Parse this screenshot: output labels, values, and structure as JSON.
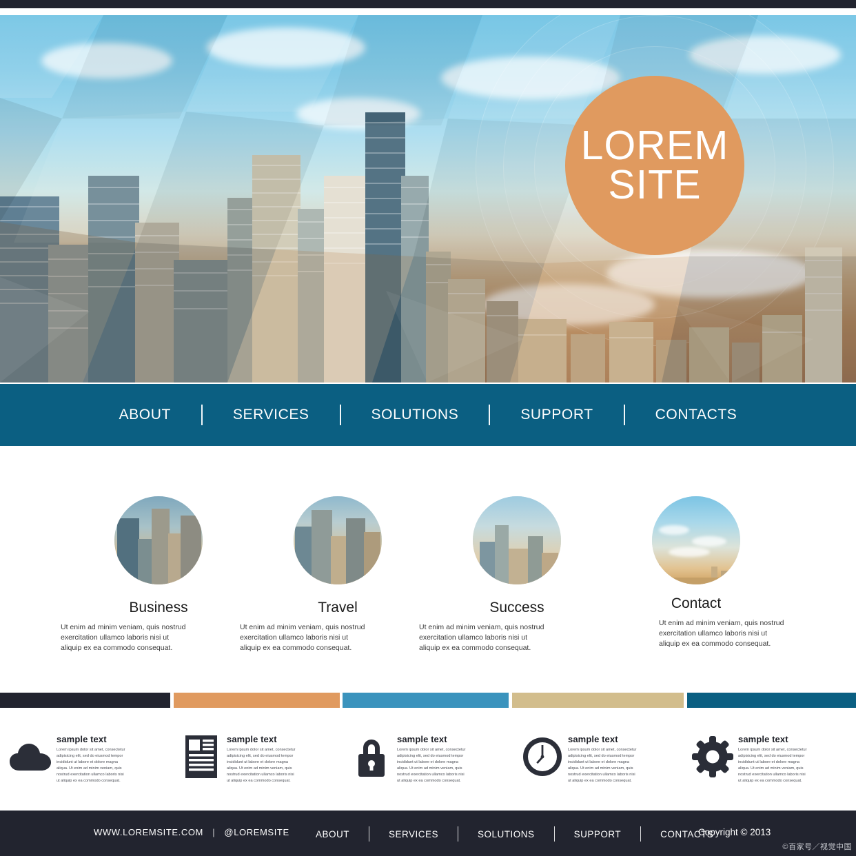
{
  "meta": {
    "colors": {
      "dark": "#22242f",
      "orange": "#e09a5f",
      "light_blue": "#3a93bd",
      "khaki": "#d2bd8c",
      "teal": "#0b5f82"
    }
  },
  "hero": {
    "logo_line1": "LOREM",
    "logo_line2": "SITE"
  },
  "nav": {
    "items": [
      {
        "label": "ABOUT"
      },
      {
        "label": "SERVICES"
      },
      {
        "label": "SOLUTIONS"
      },
      {
        "label": "SUPPORT"
      },
      {
        "label": "CONTACTS"
      }
    ]
  },
  "features": [
    {
      "title": "Business",
      "body": "Ut enim ad minim veniam, quis nostrud exercitation ullamco laboris nisi ut aliquip ex ea commodo consequat.",
      "image": "city-skyline-photo"
    },
    {
      "title": "Travel",
      "body": "Ut enim ad minim veniam, quis nostrud exercitation ullamco laboris nisi ut aliquip ex ea commodo consequat.",
      "image": "city-skyline-photo"
    },
    {
      "title": "Success",
      "body": "Ut enim ad minim veniam, quis nostrud exercitation ullamco laboris nisi ut aliquip ex ea commodo consequat.",
      "image": "city-skyline-photo"
    },
    {
      "title": "Contact",
      "body": "Ut enim ad minim veniam, quis nostrud exercitation ullamco laboris nisi ut aliquip ex ea commodo consequat.",
      "image": "sky-clouds-photo"
    }
  ],
  "color_bars": [
    {
      "color": "#22242f"
    },
    {
      "color": "#e09a5f"
    },
    {
      "color": "#3a93bd"
    },
    {
      "color": "#d2bd8c"
    },
    {
      "color": "#0b5f82"
    }
  ],
  "icon_row": [
    {
      "icon": "cloud-icon",
      "title": "sample text",
      "body": "Lorem ipsum dolor sit amet, consectetur adipisicing elit, sed do eiusmod tempor incididunt ut labore et dolore magna aliqua. Ut enim ad minim veniam, quis nostrud exercitation ullamco laboris nisi ut aliquip ex ea commodo consequat."
    },
    {
      "icon": "document-icon",
      "title": "sample text",
      "body": "Lorem ipsum dolor sit amet, consectetur adipisicing elit, sed do eiusmod tempor incididunt ut labore et dolore magna aliqua. Ut enim ad minim veniam, quis nostrud exercitation ullamco laboris nisi ut aliquip ex ea commodo consequat."
    },
    {
      "icon": "lock-icon",
      "title": "sample text",
      "body": "Lorem ipsum dolor sit amet, consectetur adipisicing elit, sed do eiusmod tempor incididunt ut labore et dolore magna aliqua. Ut enim ad minim veniam, quis nostrud exercitation ullamco laboris nisi ut aliquip ex ea commodo consequat."
    },
    {
      "icon": "clock-icon",
      "title": "sample text",
      "body": "Lorem ipsum dolor sit amet, consectetur adipisicing elit, sed do eiusmod tempor incididunt ut labore et dolore magna aliqua. Ut enim ad minim veniam, quis nostrud exercitation ullamco laboris nisi ut aliquip ex ea commodo consequat."
    },
    {
      "icon": "gear-icon",
      "title": "sample text",
      "body": "Lorem ipsum dolor sit amet, consectetur adipisicing elit, sed do eiusmod tempor incididunt ut labore et dolore magna aliqua. Ut enim ad minim veniam, quis nostrud exercitation ullamco laboris nisi ut aliquip ex ea commodo consequat."
    }
  ],
  "footer": {
    "site_url": "WWW.LOREMSITE.COM",
    "separator": "|",
    "handle": "@LOREMSITE",
    "nav": [
      {
        "label": "ABOUT"
      },
      {
        "label": "SERVICES"
      },
      {
        "label": "SOLUTIONS"
      },
      {
        "label": "SUPPORT"
      },
      {
        "label": "CONTACTS"
      }
    ],
    "copyright": "Copyright © 2013"
  },
  "watermark": "©百家号／视觉中国"
}
